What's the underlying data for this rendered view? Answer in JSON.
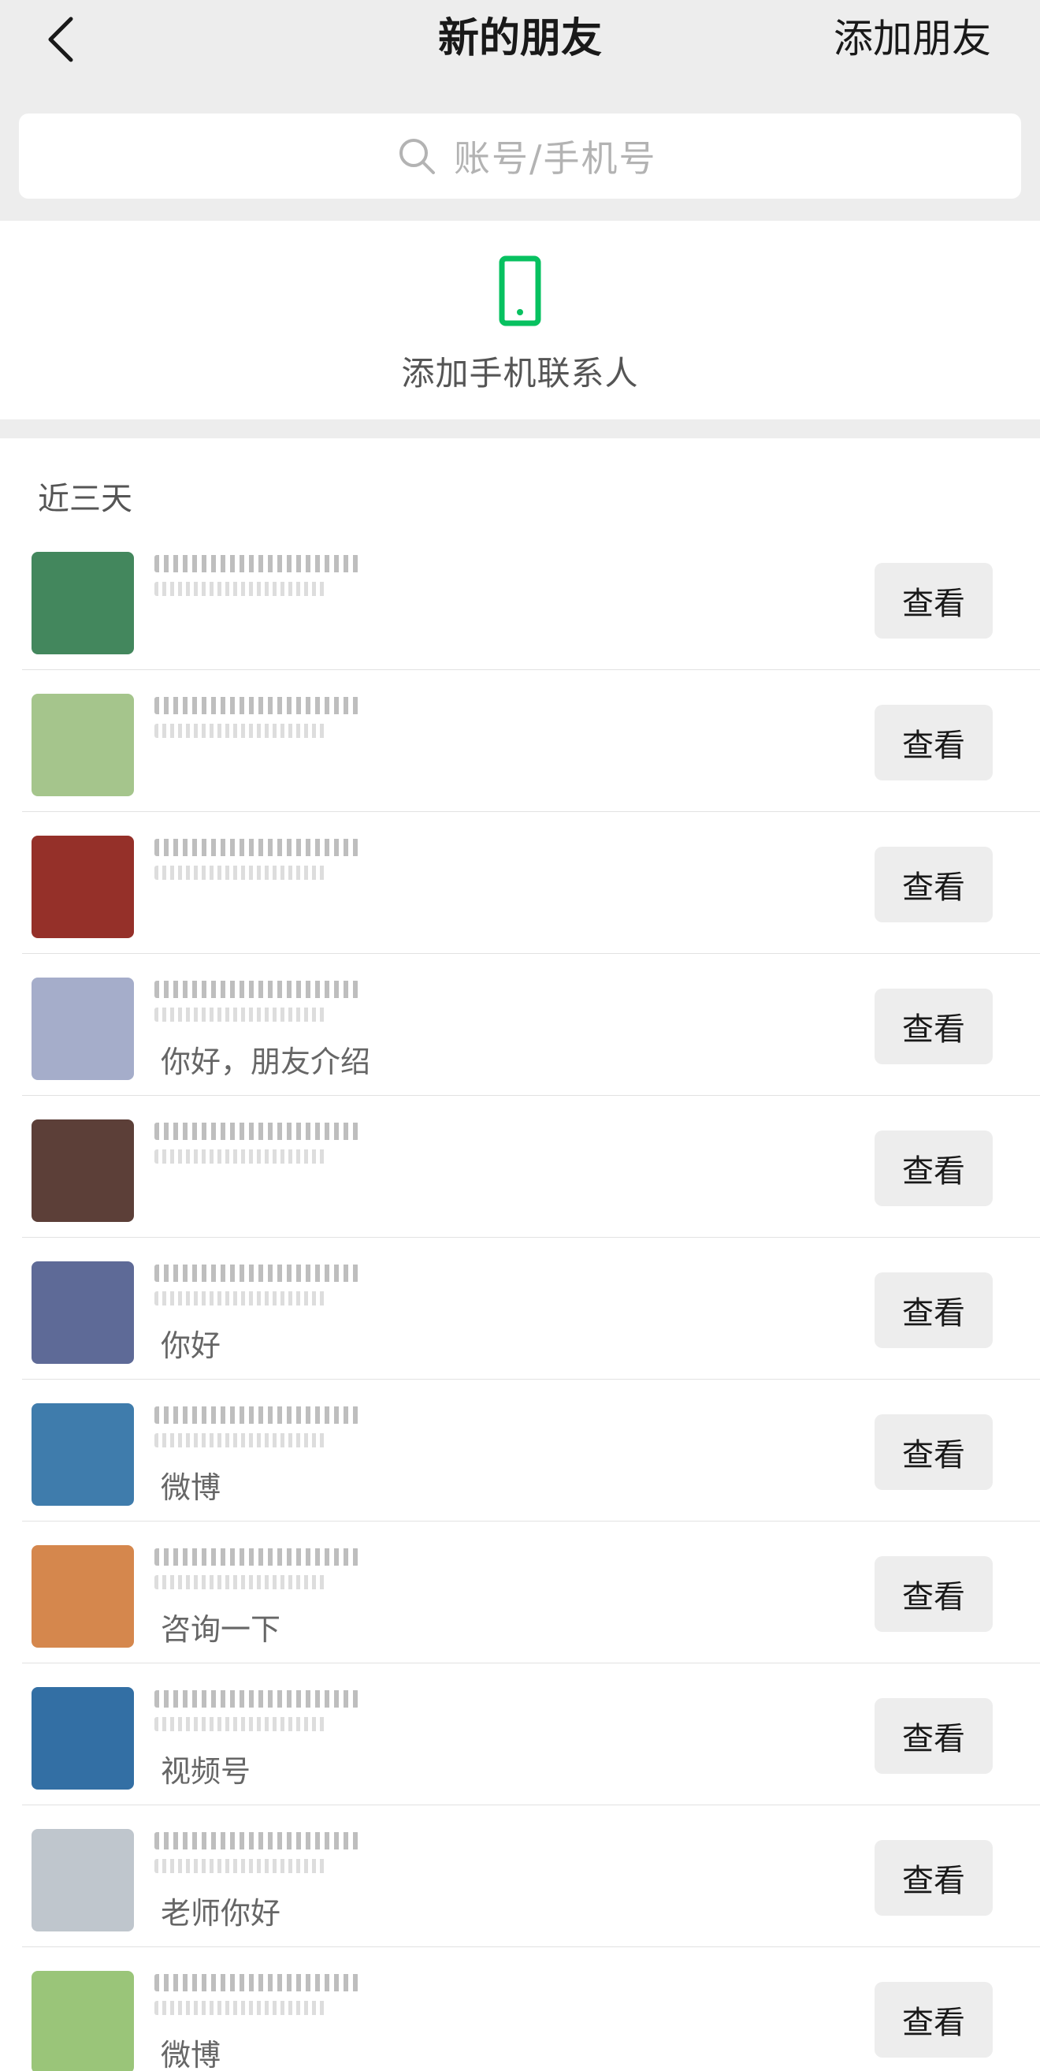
{
  "nav": {
    "title": "新的朋友",
    "add_label": "添加朋友"
  },
  "search": {
    "placeholder": "账号/手机号"
  },
  "phone_contacts": {
    "label": "添加手机联系人",
    "icon": "phone-icon",
    "icon_color": "#07c160"
  },
  "section": {
    "title": "近三天"
  },
  "requests": [
    {
      "message": "",
      "button": "查看",
      "avatar_color": "#2f7a4b"
    },
    {
      "message": "",
      "button": "查看",
      "avatar_color": "#9bbf7f"
    },
    {
      "message": "",
      "button": "查看",
      "avatar_color": "#8a1a12"
    },
    {
      "message": "你好，朋友介绍",
      "button": "查看",
      "avatar_color": "#9ba4c4"
    },
    {
      "message": "",
      "button": "查看",
      "avatar_color": "#4a2a22"
    },
    {
      "message": "你好",
      "button": "查看",
      "avatar_color": "#4d5a8c"
    },
    {
      "message": "微博",
      "button": "查看",
      "avatar_color": "#2a6ea3"
    },
    {
      "message": "咨询一下",
      "button": "查看",
      "avatar_color": "#d07a3a"
    },
    {
      "message": "视频号",
      "button": "查看",
      "avatar_color": "#1d5f9a"
    },
    {
      "message": "老师你好",
      "button": "查看",
      "avatar_color": "#b8c0c8"
    },
    {
      "message": "微博",
      "button": "查看",
      "avatar_color": "#8fbf6a"
    }
  ]
}
